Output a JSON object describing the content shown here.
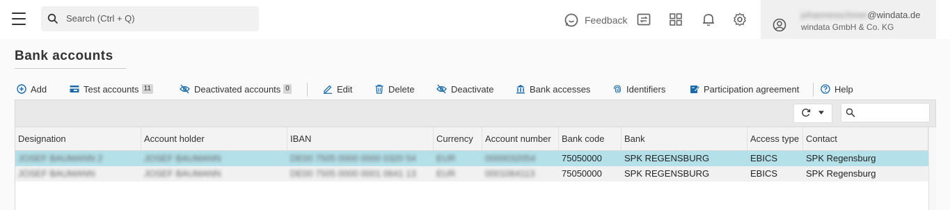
{
  "search": {
    "placeholder": "Search (Ctrl + Q)"
  },
  "topbar": {
    "feedback_label": "Feedback",
    "icons": [
      "feedback-icon",
      "switch-icon",
      "apps-grid-icon",
      "bell-icon",
      "gear-icon"
    ]
  },
  "user": {
    "email_local": "johannesschmer",
    "email_domain": "@windata.de",
    "company": "windata GmbH & Co. KG"
  },
  "page": {
    "title": "Bank accounts"
  },
  "toolbar": {
    "add": "Add",
    "test_accounts": "Test accounts",
    "test_accounts_count": "11",
    "deactivated_accounts": "Deactivated accounts",
    "deactivated_accounts_count": "0",
    "edit": "Edit",
    "delete": "Delete",
    "deactivate": "Deactivate",
    "bank_accesses": "Bank accesses",
    "identifiers": "Identifiers",
    "participation_agreement": "Participation agreement",
    "help": "Help"
  },
  "colors": {
    "accent": "#1a6aa8",
    "selected_row": "#b3e0e9"
  },
  "table": {
    "columns": [
      "Designation",
      "Account holder",
      "IBAN",
      "Currency",
      "Account number",
      "Bank code",
      "Bank",
      "Access type",
      "Contact"
    ],
    "rows": [
      [
        "JOSEF BAUMANN 2",
        "JOSEF BAUMANN",
        "DE00 7505 0000 0000 0320 54",
        "EUR",
        "0000032054",
        "75050000",
        "SPK REGENSBURG",
        "EBICS",
        "SPK Regensburg"
      ],
      [
        "JOSEF BAUMANN",
        "JOSEF BAUMANN",
        "DE00 7505 0000 0001 0641 13",
        "EUR",
        "0001064113",
        "75050000",
        "SPK REGENSBURG",
        "EBICS",
        "SPK Regensburg"
      ]
    ]
  }
}
